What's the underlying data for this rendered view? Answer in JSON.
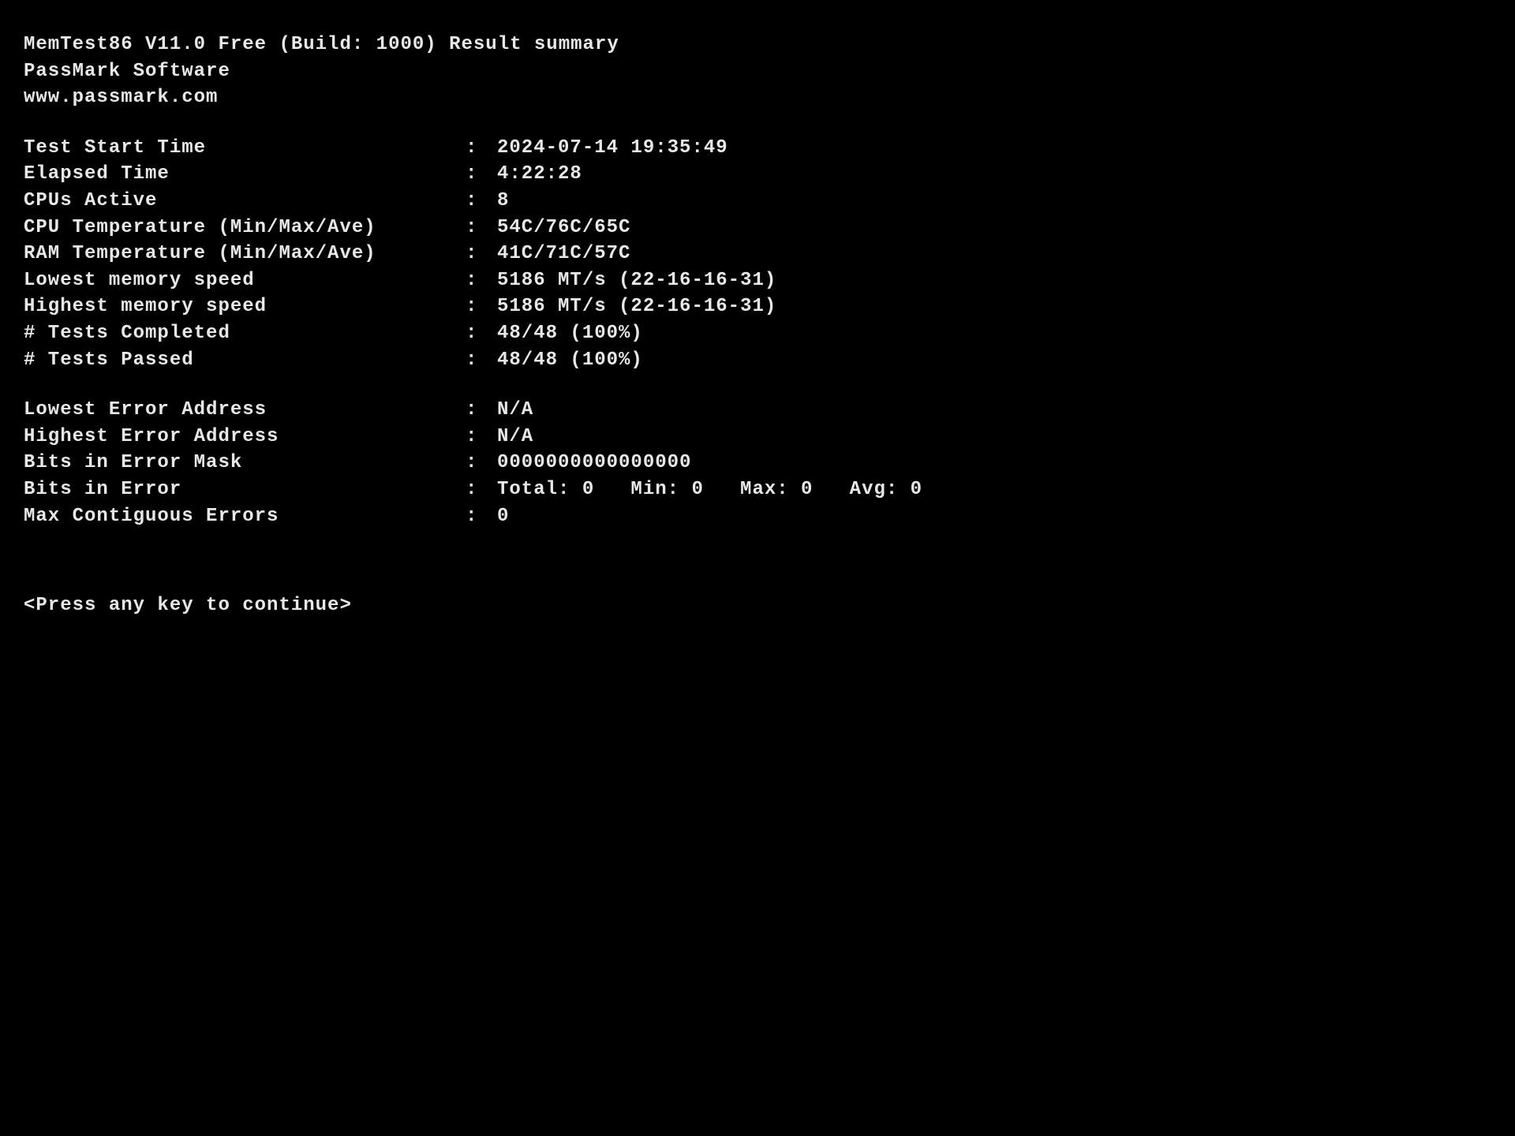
{
  "header": {
    "title": "MemTest86 V11.0 Free (Build: 1000) Result summary",
    "company": "PassMark Software",
    "website": "www.passmark.com"
  },
  "test_info": {
    "start_time_label": "Test Start Time",
    "start_time_value": "2024-07-14 19:35:49",
    "elapsed_label": "Elapsed Time",
    "elapsed_value": "4:22:28",
    "cpus_active_label": "CPUs Active",
    "cpus_active_value": "8",
    "cpu_temp_label": "CPU Temperature (Min/Max/Ave)",
    "cpu_temp_value": "54C/76C/65C",
    "ram_temp_label": "RAM Temperature (Min/Max/Ave)",
    "ram_temp_value": "41C/71C/57C",
    "lowest_speed_label": "Lowest memory speed",
    "lowest_speed_value": "5186 MT/s (22-16-16-31)",
    "highest_speed_label": "Highest memory speed",
    "highest_speed_value": "5186 MT/s (22-16-16-31)",
    "tests_completed_label": "# Tests Completed",
    "tests_completed_value": "48/48 (100%)",
    "tests_passed_label": "# Tests Passed",
    "tests_passed_value": "48/48 (100%)"
  },
  "error_info": {
    "lowest_addr_label": "Lowest Error Address",
    "lowest_addr_value": "N/A",
    "highest_addr_label": "Highest Error Address",
    "highest_addr_value": "N/A",
    "bits_mask_label": "Bits in Error Mask",
    "bits_mask_value": "0000000000000000",
    "bits_error_label": "Bits in Error",
    "bits_error_value": "Total: 0   Min: 0   Max: 0   Avg: 0",
    "max_contig_label": "Max Contiguous Errors",
    "max_contig_value": "0"
  },
  "prompt": "<Press any key to continue>",
  "colon": ":"
}
